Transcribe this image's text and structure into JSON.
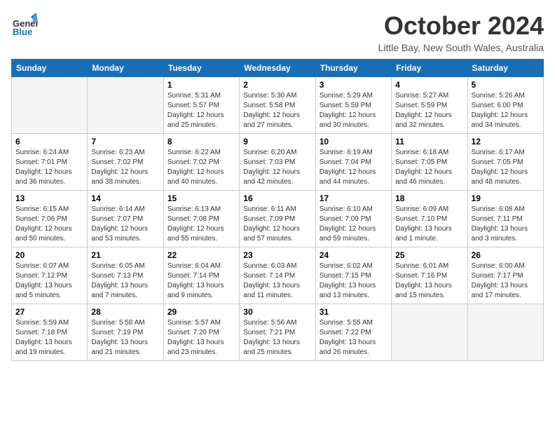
{
  "logo": {
    "line1": "General",
    "line2": "Blue"
  },
  "title": "October 2024",
  "location": "Little Bay, New South Wales, Australia",
  "days_header": [
    "Sunday",
    "Monday",
    "Tuesday",
    "Wednesday",
    "Thursday",
    "Friday",
    "Saturday"
  ],
  "weeks": [
    [
      {
        "num": "",
        "info": ""
      },
      {
        "num": "",
        "info": ""
      },
      {
        "num": "1",
        "info": "Sunrise: 5:31 AM\nSunset: 5:57 PM\nDaylight: 12 hours\nand 25 minutes."
      },
      {
        "num": "2",
        "info": "Sunrise: 5:30 AM\nSunset: 5:58 PM\nDaylight: 12 hours\nand 27 minutes."
      },
      {
        "num": "3",
        "info": "Sunrise: 5:29 AM\nSunset: 5:59 PM\nDaylight: 12 hours\nand 30 minutes."
      },
      {
        "num": "4",
        "info": "Sunrise: 5:27 AM\nSunset: 5:59 PM\nDaylight: 12 hours\nand 32 minutes."
      },
      {
        "num": "5",
        "info": "Sunrise: 5:26 AM\nSunset: 6:00 PM\nDaylight: 12 hours\nand 34 minutes."
      }
    ],
    [
      {
        "num": "6",
        "info": "Sunrise: 6:24 AM\nSunset: 7:01 PM\nDaylight: 12 hours\nand 36 minutes."
      },
      {
        "num": "7",
        "info": "Sunrise: 6:23 AM\nSunset: 7:02 PM\nDaylight: 12 hours\nand 38 minutes."
      },
      {
        "num": "8",
        "info": "Sunrise: 6:22 AM\nSunset: 7:02 PM\nDaylight: 12 hours\nand 40 minutes."
      },
      {
        "num": "9",
        "info": "Sunrise: 6:20 AM\nSunset: 7:03 PM\nDaylight: 12 hours\nand 42 minutes."
      },
      {
        "num": "10",
        "info": "Sunrise: 6:19 AM\nSunset: 7:04 PM\nDaylight: 12 hours\nand 44 minutes."
      },
      {
        "num": "11",
        "info": "Sunrise: 6:18 AM\nSunset: 7:05 PM\nDaylight: 12 hours\nand 46 minutes."
      },
      {
        "num": "12",
        "info": "Sunrise: 6:17 AM\nSunset: 7:05 PM\nDaylight: 12 hours\nand 48 minutes."
      }
    ],
    [
      {
        "num": "13",
        "info": "Sunrise: 6:15 AM\nSunset: 7:06 PM\nDaylight: 12 hours\nand 50 minutes."
      },
      {
        "num": "14",
        "info": "Sunrise: 6:14 AM\nSunset: 7:07 PM\nDaylight: 12 hours\nand 53 minutes."
      },
      {
        "num": "15",
        "info": "Sunrise: 6:13 AM\nSunset: 7:08 PM\nDaylight: 12 hours\nand 55 minutes."
      },
      {
        "num": "16",
        "info": "Sunrise: 6:11 AM\nSunset: 7:09 PM\nDaylight: 12 hours\nand 57 minutes."
      },
      {
        "num": "17",
        "info": "Sunrise: 6:10 AM\nSunset: 7:09 PM\nDaylight: 12 hours\nand 59 minutes."
      },
      {
        "num": "18",
        "info": "Sunrise: 6:09 AM\nSunset: 7:10 PM\nDaylight: 13 hours\nand 1 minute."
      },
      {
        "num": "19",
        "info": "Sunrise: 6:08 AM\nSunset: 7:11 PM\nDaylight: 13 hours\nand 3 minutes."
      }
    ],
    [
      {
        "num": "20",
        "info": "Sunrise: 6:07 AM\nSunset: 7:12 PM\nDaylight: 13 hours\nand 5 minutes."
      },
      {
        "num": "21",
        "info": "Sunrise: 6:05 AM\nSunset: 7:13 PM\nDaylight: 13 hours\nand 7 minutes."
      },
      {
        "num": "22",
        "info": "Sunrise: 6:04 AM\nSunset: 7:14 PM\nDaylight: 13 hours\nand 9 minutes."
      },
      {
        "num": "23",
        "info": "Sunrise: 6:03 AM\nSunset: 7:14 PM\nDaylight: 13 hours\nand 11 minutes."
      },
      {
        "num": "24",
        "info": "Sunrise: 6:02 AM\nSunset: 7:15 PM\nDaylight: 13 hours\nand 13 minutes."
      },
      {
        "num": "25",
        "info": "Sunrise: 6:01 AM\nSunset: 7:16 PM\nDaylight: 13 hours\nand 15 minutes."
      },
      {
        "num": "26",
        "info": "Sunrise: 6:00 AM\nSunset: 7:17 PM\nDaylight: 13 hours\nand 17 minutes."
      }
    ],
    [
      {
        "num": "27",
        "info": "Sunrise: 5:59 AM\nSunset: 7:18 PM\nDaylight: 13 hours\nand 19 minutes."
      },
      {
        "num": "28",
        "info": "Sunrise: 5:58 AM\nSunset: 7:19 PM\nDaylight: 13 hours\nand 21 minutes."
      },
      {
        "num": "29",
        "info": "Sunrise: 5:57 AM\nSunset: 7:20 PM\nDaylight: 13 hours\nand 23 minutes."
      },
      {
        "num": "30",
        "info": "Sunrise: 5:56 AM\nSunset: 7:21 PM\nDaylight: 13 hours\nand 25 minutes."
      },
      {
        "num": "31",
        "info": "Sunrise: 5:55 AM\nSunset: 7:22 PM\nDaylight: 13 hours\nand 26 minutes."
      },
      {
        "num": "",
        "info": ""
      },
      {
        "num": "",
        "info": ""
      }
    ]
  ]
}
